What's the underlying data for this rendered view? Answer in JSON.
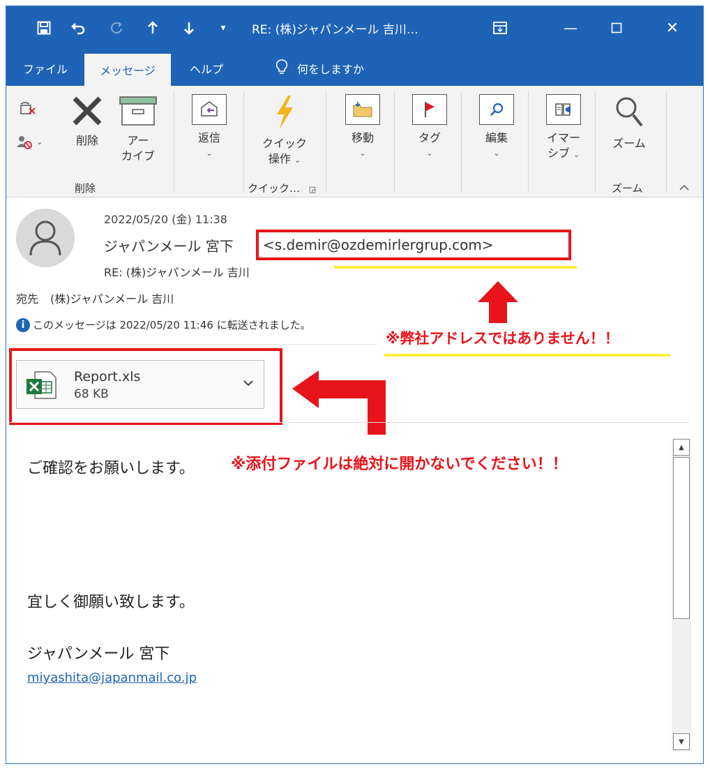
{
  "titlebar": {
    "title": "RE: (株)ジャパンメール 吉川…",
    "icons": [
      "save-icon",
      "undo-icon",
      "redo-icon",
      "up-arrow-icon",
      "down-arrow-icon",
      "customize-icon",
      "ribbon-display-icon",
      "minimize-icon",
      "maximize-icon",
      "close-icon"
    ],
    "glyphs": {
      "customize": "▾",
      "ribbon": "⊡",
      "minimize": "—",
      "maximize": "☐",
      "close": "✕"
    }
  },
  "tabs": [
    {
      "label": "ファイル"
    },
    {
      "label": "メッセージ"
    },
    {
      "label": "ヘルプ"
    },
    {
      "label": "何をしますか"
    }
  ],
  "ribbon": {
    "delete": {
      "label": "削除"
    },
    "archive": {
      "line1": "アー",
      "line2": "カイブ"
    },
    "group_delete": "削除",
    "reply": {
      "label": "返信"
    },
    "quick": {
      "line1": "クイック",
      "line2": "操作"
    },
    "group_quick": "クイック…",
    "move": {
      "label": "移動"
    },
    "tags": {
      "label": "タグ"
    },
    "editing": {
      "label": "編集"
    },
    "immersive": {
      "line1": "イマー",
      "line2": "シブ"
    },
    "zoom": {
      "label": "ズーム"
    },
    "group_zoom": "ズーム"
  },
  "header": {
    "date": "2022/05/20 (金) 11:38",
    "sender_name": "ジャパンメール 宮下",
    "sender_email": "<s.demir@ozdemirlergrup.com>",
    "subject": "RE: (株)ジャパンメール 吉川",
    "to_label": "宛先",
    "to_value": "(株)ジャパンメール 吉川",
    "info": "このメッセージは 2022/05/20 11:46 に転送されました。"
  },
  "annotations": {
    "address_warning": "※弊社アドレスではありません！！",
    "attachment_warning": "※添付ファイルは絶対に開かないでください！！",
    "highlight_red": "#e8141b",
    "highlight_yellow": "#ffef3a"
  },
  "attachment": {
    "name": "Report.xls",
    "size": "68 KB",
    "icon": "excel-file-icon"
  },
  "body": {
    "line1": "ご確認をお願いします。",
    "line2": "宜しく御願い致します。",
    "signature": "ジャパンメール 宮下",
    "signature_email": "miyashita@japanmail.co.jp"
  },
  "colors": {
    "accent": "#1e63b5",
    "ribbon_bg": "#f3f3f3"
  }
}
